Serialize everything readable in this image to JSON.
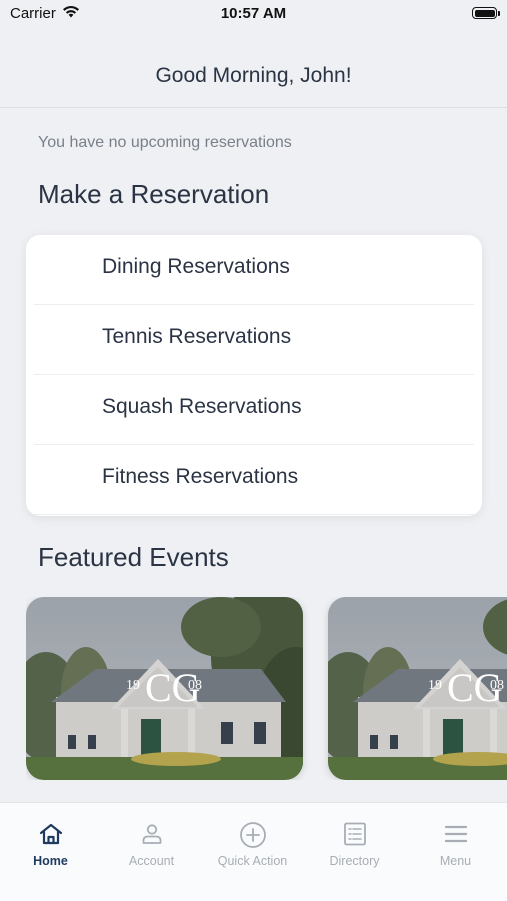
{
  "status_bar": {
    "carrier": "Carrier",
    "time": "10:57 AM"
  },
  "header": {
    "greeting": "Good Morning, John!"
  },
  "reservations": {
    "empty_message": "You have no upcoming reservations",
    "section_title": "Make a Reservation",
    "items": [
      {
        "label": "Dining Reservations"
      },
      {
        "label": "Tennis Reservations"
      },
      {
        "label": "Squash Reservations"
      },
      {
        "label": "Fitness Reservations"
      }
    ]
  },
  "events": {
    "section_title": "Featured Events",
    "cards": [
      {
        "logo_text_left": "19",
        "logo_text_right": "08",
        "logo_monogram": "CG"
      },
      {
        "logo_text_left": "19",
        "logo_text_right": "08",
        "logo_monogram": "CG"
      }
    ]
  },
  "tab_bar": {
    "tabs": [
      {
        "label": "Home",
        "icon": "home-icon",
        "active": true
      },
      {
        "label": "Account",
        "icon": "account-icon",
        "active": false
      },
      {
        "label": "Quick Action",
        "icon": "plus-circle-icon",
        "active": false
      },
      {
        "label": "Directory",
        "icon": "directory-icon",
        "active": false
      },
      {
        "label": "Menu",
        "icon": "hamburger-menu-icon",
        "active": false
      }
    ]
  },
  "colors": {
    "accent": "#1f3a5f",
    "inactive": "#a8adb5",
    "background": "#eef0f3",
    "text": "#2b3444"
  }
}
